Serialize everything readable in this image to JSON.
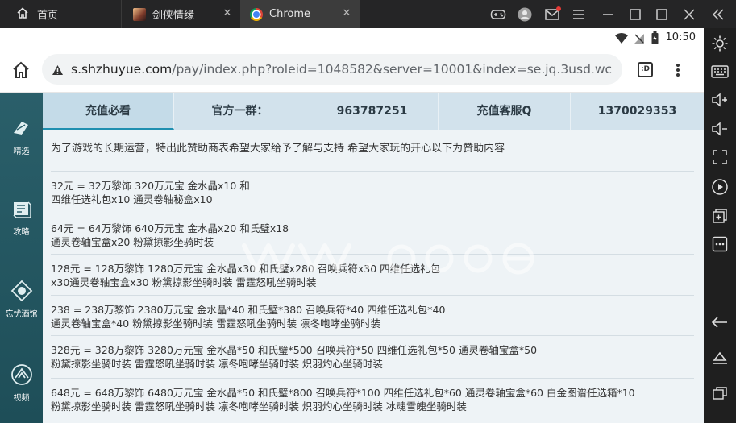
{
  "tabs": [
    {
      "label": "首页"
    },
    {
      "label": "剑侠情缘"
    },
    {
      "label": "Chrome"
    }
  ],
  "status_bar": {
    "time": "10:50"
  },
  "browser": {
    "url_host": "s.shzhuyue.com",
    "url_path": "/pay/index.php?roleid=1048582&server=10001&index=se.jq.3usd.wc",
    "tab_count": ":D"
  },
  "site_sidebar": [
    {
      "label": "精选"
    },
    {
      "label": "攻略"
    },
    {
      "label": "忘忧酒馆"
    },
    {
      "label": "视频"
    }
  ],
  "info_bar": [
    {
      "label": "充值必看"
    },
    {
      "label": "官方一群："
    },
    {
      "label": "963787251"
    },
    {
      "label": "充值客服Q"
    },
    {
      "label": "1370029353"
    }
  ],
  "intro": "为了游戏的长期运营，特出此赞助商表希望大家给予了解与支持 希望大家玩的开心以下为赞助内容",
  "packages": [
    {
      "line1": "32元 = 32万黎饰 320万元宝 金水晶x10 和",
      "line2": "四维任选礼包x10 通灵卷轴秘盒x10"
    },
    {
      "line1": "64元 = 64万黎饰 640万元宝 金水晶x20 和氏璧x18",
      "line2": "通灵卷轴宝盒x20 粉黛掠影坐骑时装"
    },
    {
      "line1": "128元 = 128万黎饰 1280万元宝 金水晶x30 和氏璧x280 召唤兵符x30 四维任选礼包",
      "line2": "x30通灵卷轴宝盒x30 粉黛掠影坐骑时装 雷霆怒吼坐骑时装"
    },
    {
      "line1": "238 = 238万黎饰 2380万元宝 金水晶*40 和氏璧*380 召唤兵符*40 四维任选礼包*40",
      "line2": "通灵卷轴宝盒*40 粉黛掠影坐骑时装 雷霆怒吼坐骑时装 凛冬咆哮坐骑时装"
    },
    {
      "line1": "328元 = 328万黎饰 3280万元宝 金水晶*50 和氏璧*500 召唤兵符*50 四维任选礼包*50 通灵卷轴宝盒*50",
      "line2": "粉黛掠影坐骑时装 雷霆怒吼坐骑时装 凛冬咆哮坐骑时装 炽羽灼心坐骑时装"
    },
    {
      "line1": "648元 = 648万黎饰 6480万元宝 金水晶*50 和氏璧*800 召唤兵符*100 四维任选礼包*60 通灵卷轴宝盒*60 白金图谱任选箱*10",
      "line2": "粉黛掠影坐骑时装 雷霆怒吼坐骑时装 凛冬咆哮坐骑时装 炽羽灼心坐骑时装 冰魂雪魄坐骑时装"
    }
  ]
}
